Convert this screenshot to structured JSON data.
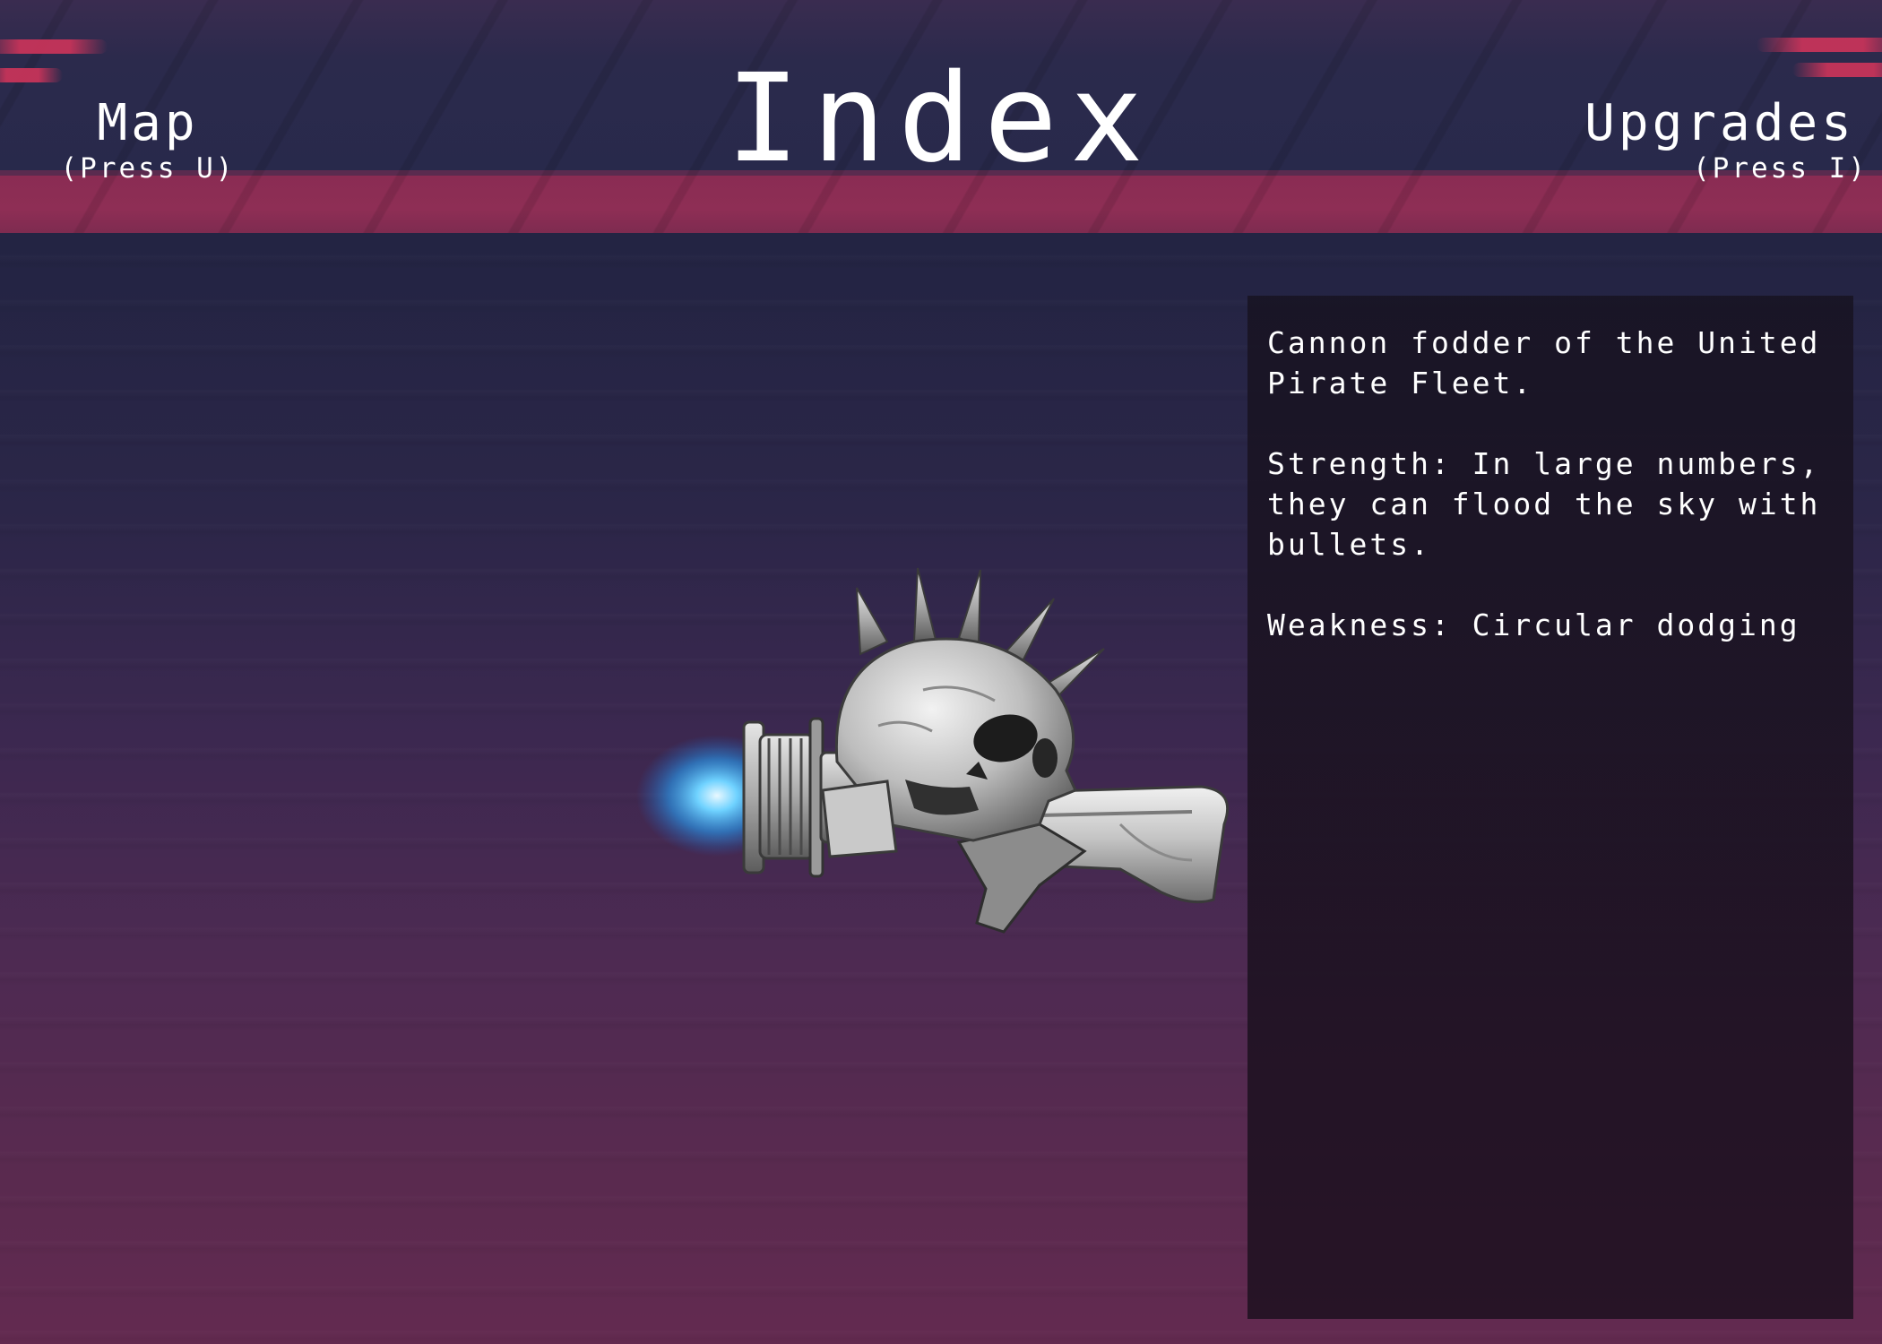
{
  "header": {
    "title": "Index",
    "left_nav": {
      "label": "Map",
      "hint": "(Press U)"
    },
    "right_nav": {
      "label": "Upgrades",
      "hint": "(Press I)"
    }
  },
  "enemy": {
    "icon": "skull-ship-icon",
    "description": "Cannon fodder of the United Pirate Fleet.",
    "strength": "Strength: In large numbers, they can flood the sky with bullets.",
    "weakness": "Weakness: Circular dodging"
  },
  "colors": {
    "header_pink": "#8e2e55",
    "thruster_glow": "#3aa8f0",
    "panel_bg": "#1c1626"
  }
}
